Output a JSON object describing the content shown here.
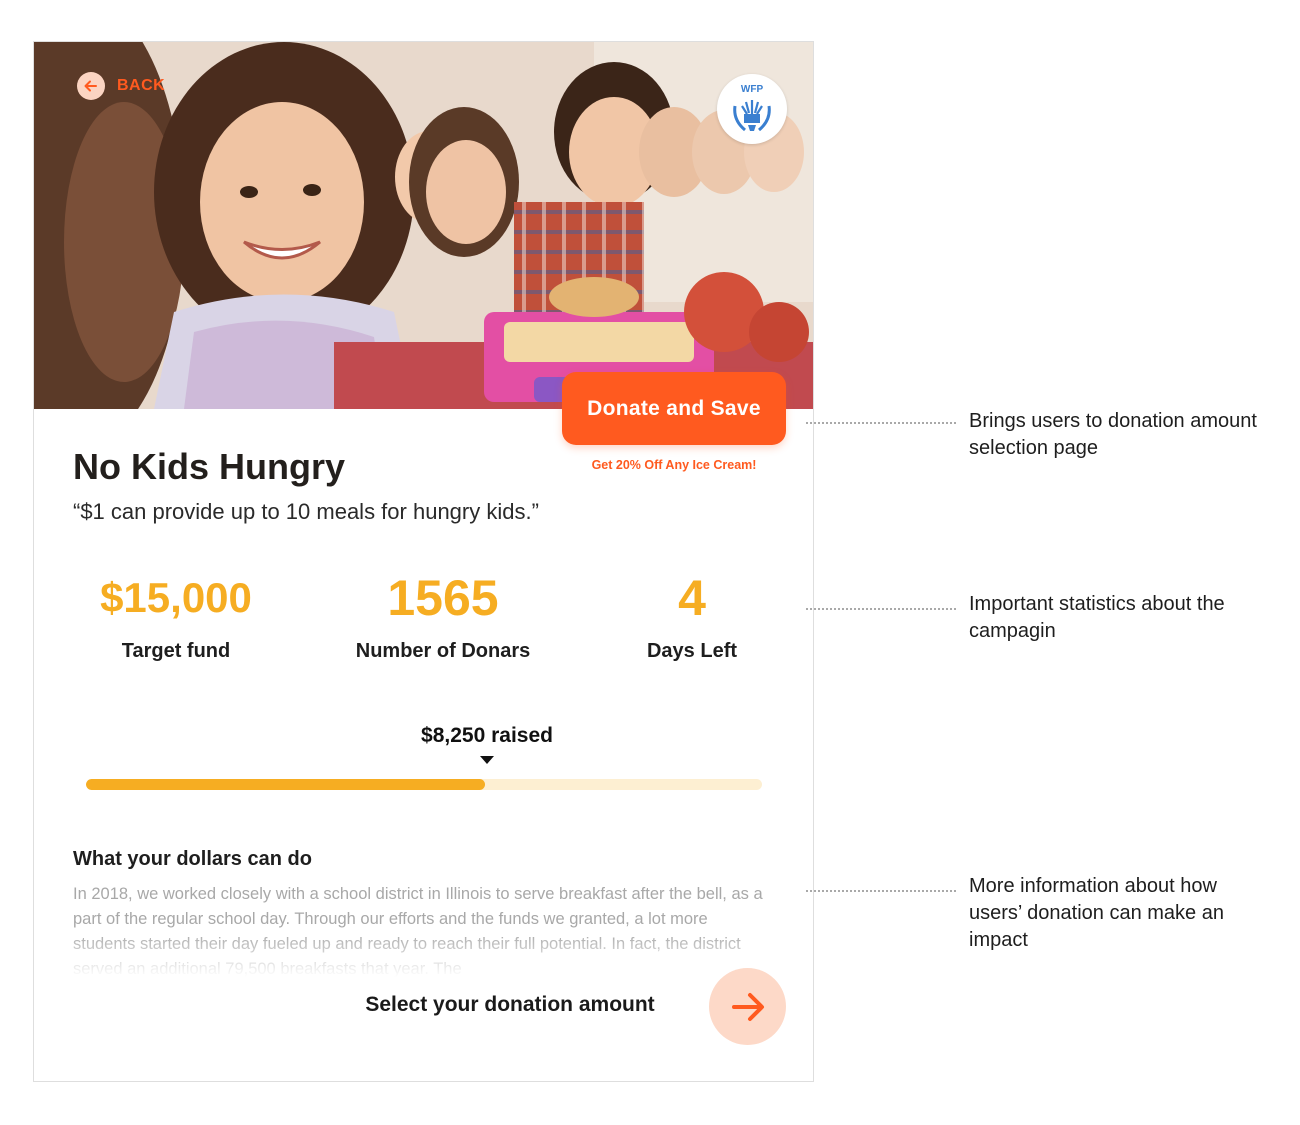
{
  "header": {
    "back_label": "BACK",
    "logo_text": "WFP"
  },
  "cta": {
    "donate_label": "Donate and Save",
    "promo_text": "Get 20% Off Any Ice Cream!"
  },
  "campaign": {
    "title": "No Kids Hungry",
    "quote": "“$1 can provide up to 10 meals for hungry kids.”"
  },
  "stats": [
    {
      "value": "$15,000",
      "label": "Target fund"
    },
    {
      "value": "1565",
      "label": "Number of Donars"
    },
    {
      "value": "4",
      "label": "Days Left"
    }
  ],
  "progress": {
    "raised_label": "$8,250 raised",
    "fraction": 0.59
  },
  "info": {
    "heading": "What your dollars can do",
    "body": "In 2018, we worked closely with a school district in Illinois to serve breakfast after the bell, as a part of the regular school day. Through our efforts and the funds we granted, a lot more students started their day fueled up and ready to reach their full potential. In fact, the district served an additional 79,500 breakfasts that year. The"
  },
  "footer": {
    "select_label": "Select your donation amount",
    "next_icon": "arrow-right-icon"
  },
  "annotations": [
    "Brings users to donation amount selection page",
    "Important statistics about the campagin",
    "More information about how users’ donation can make an impact"
  ],
  "colors": {
    "accent_orange": "#ff5a1f",
    "stat_yellow": "#f6ad22",
    "progress_track": "#fdefd2",
    "soft_orange": "#fdd9c8"
  }
}
